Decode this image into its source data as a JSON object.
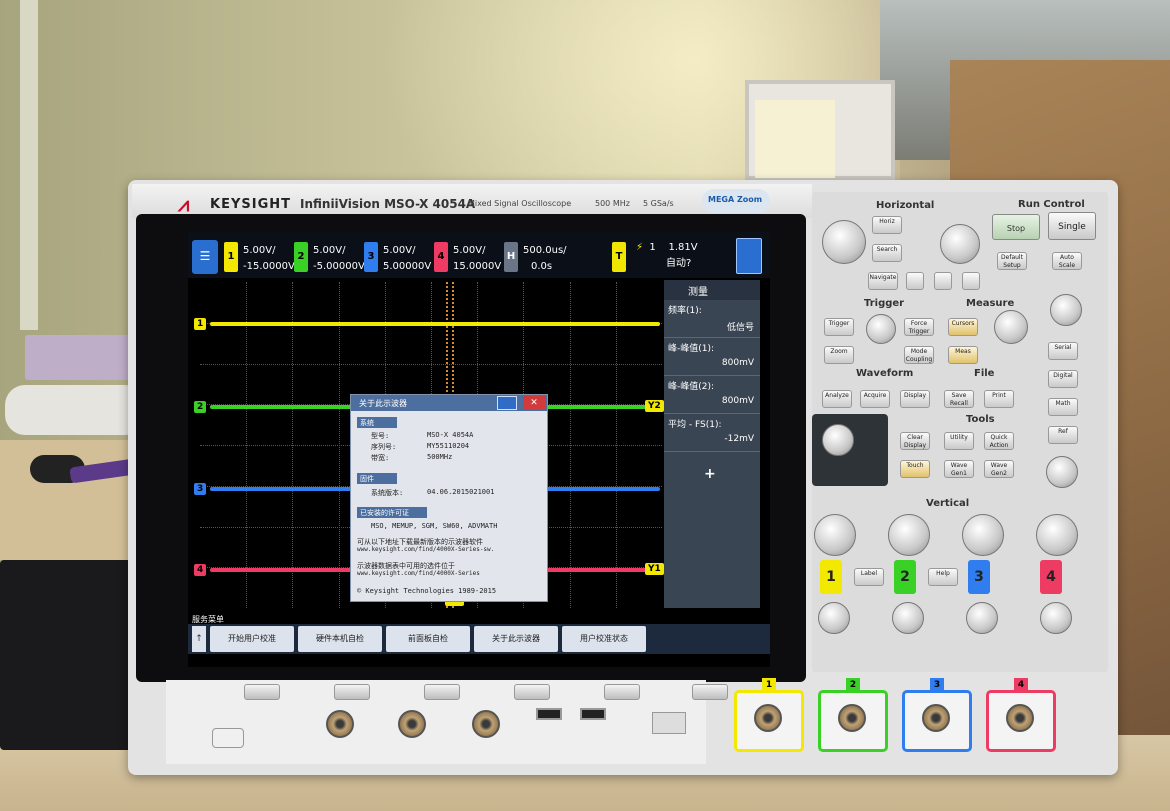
{
  "brand": {
    "mark": "⩘",
    "name": "KEYSIGHT"
  },
  "model": {
    "name": "InfiniiVision MSO-X 4054A",
    "type": "Mixed Signal Oscilloscope",
    "bandwidth": "500 MHz",
    "sample_rate": "5 GSa/s",
    "megazoom": "MEGA Zoom"
  },
  "status": {
    "channels": [
      {
        "num": "1",
        "scale": "5.00V/",
        "offset": "-15.0000V",
        "color": "#f2e800"
      },
      {
        "num": "2",
        "scale": "5.00V/",
        "offset": "-5.00000V",
        "color": "#39d125"
      },
      {
        "num": "3",
        "scale": "5.00V/",
        "offset": "5.00000V",
        "color": "#2f7dee"
      },
      {
        "num": "4",
        "scale": "5.00V/",
        "offset": "15.0000V",
        "color": "#ee3b63"
      }
    ],
    "horizontal": {
      "label": "H",
      "timebase": "500.0us/",
      "delay": "0.0s"
    },
    "trigger": {
      "label": "T",
      "source": "1",
      "level": "1.81V",
      "mode": "自动?"
    }
  },
  "traces": [
    {
      "label": "1",
      "color": "#f2e800"
    },
    {
      "label": "2",
      "color": "#39d125",
      "tag": "Y2"
    },
    {
      "label": "3",
      "color": "#2f7dee"
    },
    {
      "label": "4",
      "color": "#ee3b63",
      "tag": "Y1"
    }
  ],
  "trigger_marker": "X2",
  "measure": {
    "title": "测量",
    "rows": [
      {
        "name": "频率(1):",
        "value": "低信号"
      },
      {
        "name": "峰-峰值(1):",
        "value": "800mV"
      },
      {
        "name": "峰-峰值(2):",
        "value": "800mV"
      },
      {
        "name": "平均 - FS(1):",
        "value": "-12mV"
      }
    ],
    "add": "+"
  },
  "about": {
    "title": "关于此示波器",
    "close": "✕",
    "system_header": "系统",
    "model_label": "型号:",
    "model_value": "MSO-X 4054A",
    "serial_label": "序列号:",
    "serial_value": "MY55110204",
    "bandwidth_label": "带宽:",
    "bandwidth_value": "500MHz",
    "firmware_header": "固件",
    "firmware_label": "系统版本:",
    "firmware_value": "04.06.2015021001",
    "licenses_header": "已安装的许可证",
    "licenses": "MSO, MEMUP, SGM, SW60, ADVMATH",
    "update_text": "可从以下地址下载最新版本的示波器软件",
    "update_url": "www.keysight.com/find/4000X-Series-sw.",
    "upgrade_text": "示波器数据表中可用的选件位于",
    "upgrade_url": "www.keysight.com/find/4000X-Series",
    "copyright": "© Keysight Technologies 1989-2015"
  },
  "softkeys": {
    "title": "服务菜单",
    "first": "↑",
    "items": [
      "开始用户校准",
      "硬件本机自检",
      "前面板自检",
      "关于此示波器",
      "用户校准状态"
    ]
  },
  "panel": {
    "horizontal": "Horizontal",
    "run_control": "Run Control",
    "trigger": "Trigger",
    "measure": "Measure",
    "waveform": "Waveform",
    "file": "File",
    "tools": "Tools",
    "vertical": "Vertical",
    "run_stop": "Stop",
    "single": "Single",
    "buttons": {
      "horiz": "Horiz",
      "search": "Search",
      "navigate": "Navigate",
      "default_setup": "Default Setup",
      "auto_scale": "Auto Scale",
      "trigger": "Trigger",
      "force_trigger": "Force Trigger",
      "zoom": "Zoom",
      "mode_coupling": "Mode Coupling",
      "cursors": "Cursors",
      "meas": "Meas",
      "analyze": "Analyze",
      "acquire": "Acquire",
      "display": "Display",
      "save_recall": "Save Recall",
      "print": "Print",
      "clear_display": "Clear Display",
      "utility": "Utility",
      "quick_action": "Quick Action",
      "touch": "Touch",
      "wave_gen1": "Wave Gen1",
      "wave_gen2": "Wave Gen2",
      "serial": "Serial",
      "digital": "Digital",
      "math": "Math",
      "ref": "Ref",
      "label": "Label",
      "help": "Help"
    },
    "ch_buttons": [
      "1",
      "2",
      "3",
      "4"
    ]
  },
  "inputs": [
    "1",
    "2",
    "3",
    "4"
  ]
}
